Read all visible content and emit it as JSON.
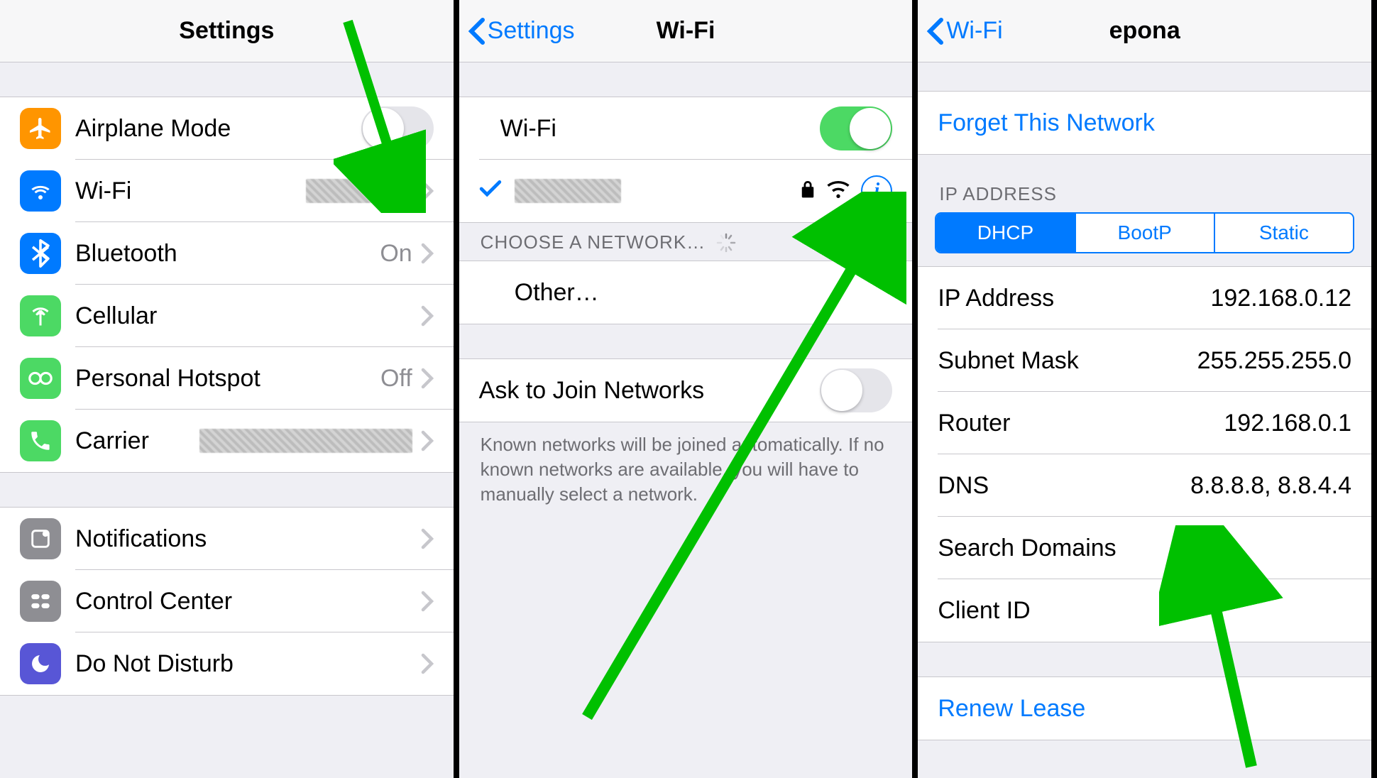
{
  "panel1": {
    "title": "Settings",
    "group1": [
      {
        "icon": "airplane",
        "color": "#ff9500",
        "label": "Airplane Mode",
        "toggle": false
      },
      {
        "icon": "wifi",
        "color": "#007aff",
        "label": "Wi-Fi",
        "value_redacted": true,
        "chevron": true
      },
      {
        "icon": "bluetooth",
        "color": "#007aff",
        "label": "Bluetooth",
        "value": "On",
        "chevron": true
      },
      {
        "icon": "cellular",
        "color": "#4cd964",
        "label": "Cellular",
        "value": "",
        "chevron": true
      },
      {
        "icon": "hotspot",
        "color": "#4cd964",
        "label": "Personal Hotspot",
        "value": "Off",
        "chevron": true
      },
      {
        "icon": "carrier",
        "color": "#4cd964",
        "label": "Carrier",
        "value_redacted_wide": true,
        "chevron": true
      }
    ],
    "group2": [
      {
        "icon": "notifications",
        "color": "#8e8e93",
        "label": "Notifications",
        "chevron": true
      },
      {
        "icon": "controlcenter",
        "color": "#8e8e93",
        "label": "Control Center",
        "chevron": true
      },
      {
        "icon": "dnd",
        "color": "#5856d6",
        "label": "Do Not Disturb",
        "chevron": true
      }
    ]
  },
  "panel2": {
    "back": "Settings",
    "title": "Wi-Fi",
    "wifi_label": "Wi-Fi",
    "wifi_on": true,
    "connected_redacted": true,
    "choose_header": "CHOOSE A NETWORK…",
    "other_label": "Other…",
    "ask_label": "Ask to Join Networks",
    "ask_on": false,
    "footer": "Known networks will be joined automatically. If no known networks are available, you will have to manually select a network."
  },
  "panel3": {
    "back": "Wi-Fi",
    "title": "epona",
    "forget": "Forget This Network",
    "ip_header": "IP ADDRESS",
    "segments": [
      "DHCP",
      "BootP",
      "Static"
    ],
    "segment_active": 0,
    "rows": [
      {
        "label": "IP Address",
        "value": "192.168.0.12"
      },
      {
        "label": "Subnet Mask",
        "value": "255.255.255.0"
      },
      {
        "label": "Router",
        "value": "192.168.0.1"
      },
      {
        "label": "DNS",
        "value": "8.8.8.8, 8.8.4.4"
      },
      {
        "label": "Search Domains",
        "value": ""
      },
      {
        "label": "Client ID",
        "value": ""
      }
    ],
    "renew": "Renew Lease"
  }
}
